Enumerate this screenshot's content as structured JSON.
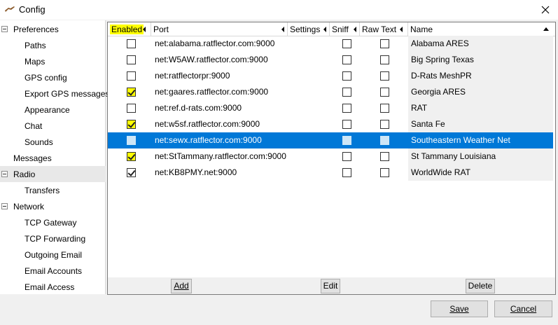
{
  "window": {
    "title": "Config"
  },
  "tree": {
    "items": [
      {
        "label": "Preferences",
        "level": 0,
        "expander": true
      },
      {
        "label": "Paths",
        "level": 1
      },
      {
        "label": "Maps",
        "level": 1
      },
      {
        "label": "GPS config",
        "level": 1
      },
      {
        "label": "Export GPS messages",
        "level": 1
      },
      {
        "label": "Appearance",
        "level": 1
      },
      {
        "label": "Chat",
        "level": 1
      },
      {
        "label": "Sounds",
        "level": 1
      },
      {
        "label": "Messages",
        "level": 0
      },
      {
        "label": "Radio",
        "level": 0,
        "expander": true,
        "selected": true
      },
      {
        "label": "Transfers",
        "level": 1
      },
      {
        "label": "Network",
        "level": 0,
        "expander": true
      },
      {
        "label": "TCP Gateway",
        "level": 1
      },
      {
        "label": "TCP Forwarding",
        "level": 1
      },
      {
        "label": "Outgoing Email",
        "level": 1
      },
      {
        "label": "Email Accounts",
        "level": 1
      },
      {
        "label": "Email Access",
        "level": 1
      }
    ]
  },
  "grid": {
    "columns": {
      "enabled": "Enabled",
      "port": "Port",
      "settings": "Settings",
      "sniff": "Sniff",
      "raw_text": "Raw Text",
      "name": "Name"
    },
    "rows": [
      {
        "enabled": false,
        "highlight": false,
        "port": "net:alabama.ratflector.com:9000",
        "sniff": false,
        "raw": false,
        "name": "Alabama ARES"
      },
      {
        "enabled": false,
        "highlight": false,
        "port": "net:W5AW.ratflector.com:9000",
        "sniff": false,
        "raw": false,
        "name": "Big Spring Texas"
      },
      {
        "enabled": false,
        "highlight": false,
        "port": "net:ratflectorpr:9000",
        "sniff": false,
        "raw": false,
        "name": "D-Rats MeshPR"
      },
      {
        "enabled": true,
        "highlight": true,
        "port": "net:gaares.ratflector.com:9000",
        "sniff": false,
        "raw": false,
        "name": "Georgia ARES"
      },
      {
        "enabled": false,
        "highlight": false,
        "port": "net:ref.d-rats.com:9000",
        "sniff": false,
        "raw": false,
        "name": "RAT"
      },
      {
        "enabled": true,
        "highlight": true,
        "port": "net:w5sf.ratflector.com:9000",
        "sniff": false,
        "raw": false,
        "name": "Santa Fe"
      },
      {
        "enabled": false,
        "highlight": false,
        "port": "net:sewx.ratflector.com:9000",
        "sniff": false,
        "raw": false,
        "name": "Southeastern Weather Net",
        "selected": true
      },
      {
        "enabled": true,
        "highlight": true,
        "port": "net:StTammany.ratflector.com:9000",
        "sniff": false,
        "raw": false,
        "name": "St Tammany Louisiana"
      },
      {
        "enabled": true,
        "highlight": false,
        "port": "net:KB8PMY.net:9000",
        "sniff": false,
        "raw": false,
        "name": "WorldWide RAT"
      }
    ],
    "buttons": {
      "add": "Add",
      "edit": "Edit",
      "delete": "Delete"
    }
  },
  "dialog": {
    "save": "Save",
    "cancel": "Cancel"
  }
}
